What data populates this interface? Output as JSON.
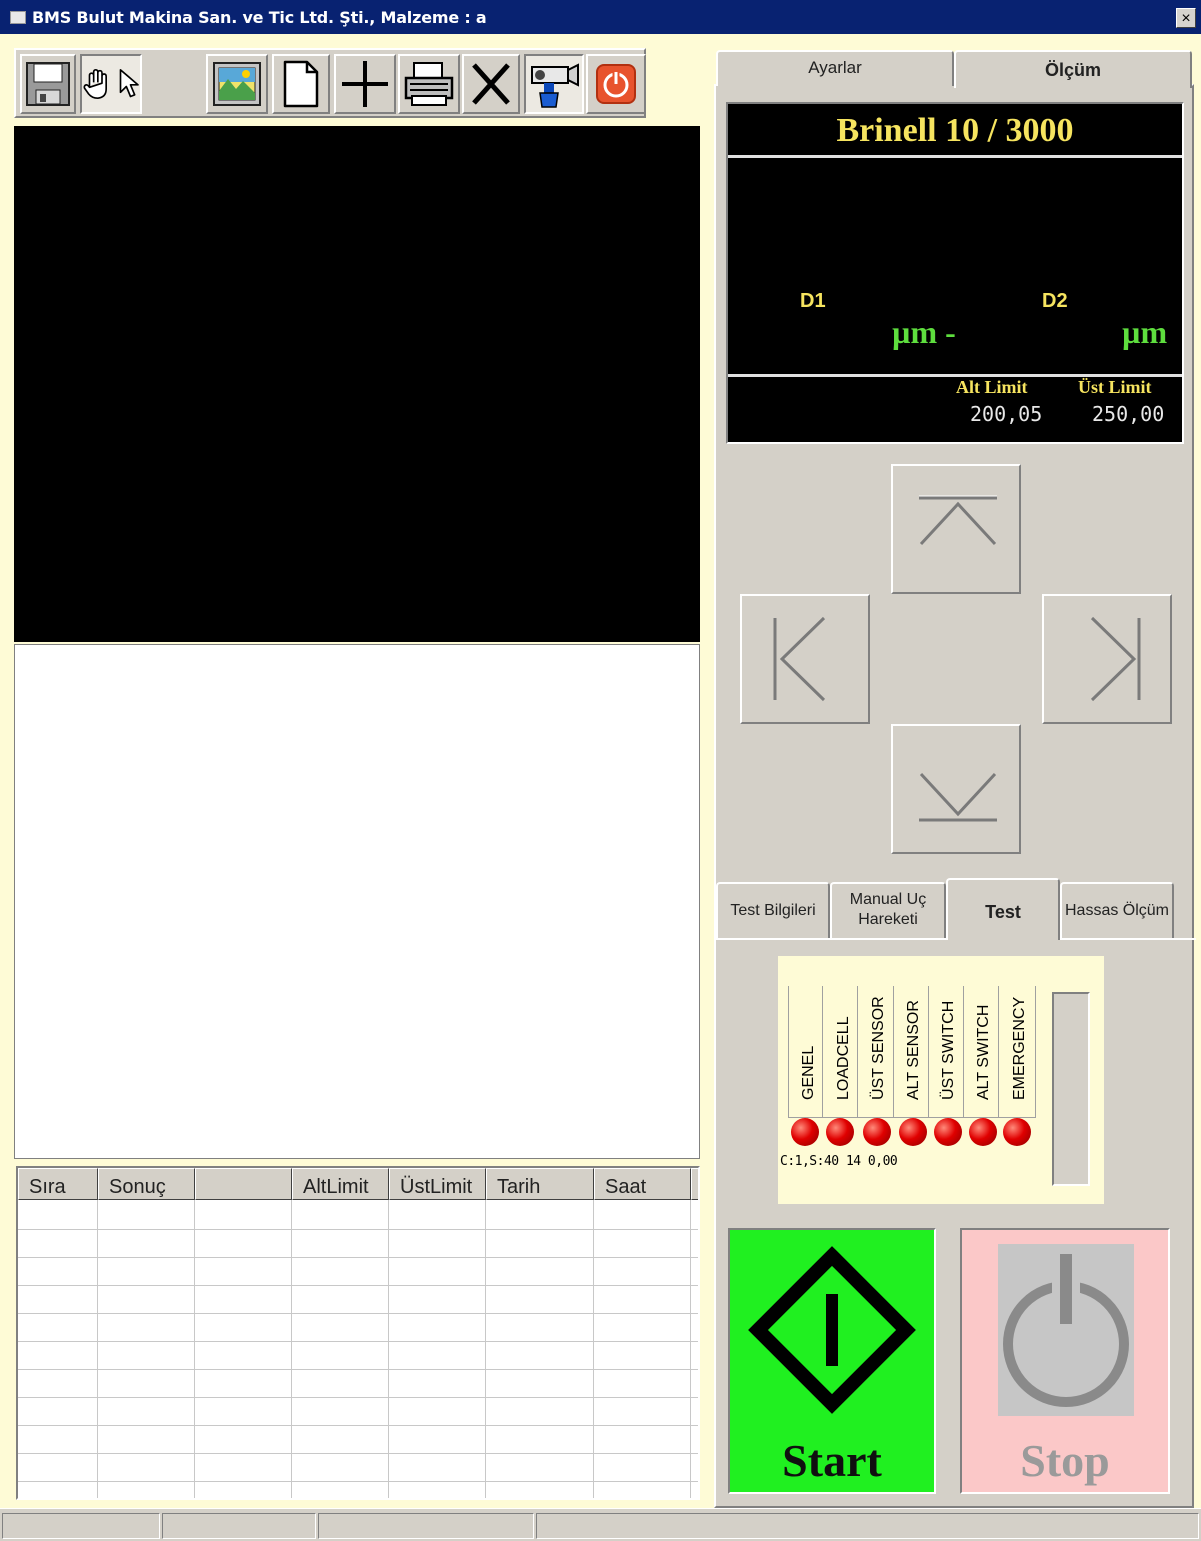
{
  "window": {
    "title": "BMS Bulut Makina San. ve Tic Ltd. Şti., Malzeme : a",
    "close": "×"
  },
  "toolbar": {
    "buttons": [
      {
        "name": "save-icon"
      },
      {
        "name": "hand-icon"
      },
      {
        "name": "pointer-icon"
      },
      {
        "name": "picture-icon"
      },
      {
        "name": "new-page-icon"
      },
      {
        "name": "crosshair-icon"
      },
      {
        "name": "print-icon"
      },
      {
        "name": "delete-icon"
      },
      {
        "name": "camera-icon"
      },
      {
        "name": "power-icon"
      }
    ]
  },
  "top_tabs": {
    "settings": "Ayarlar",
    "measurement": "Ölçüm",
    "active": "Ölçüm"
  },
  "measurement": {
    "title": "Brinell 10 / 3000",
    "d1_label": "D1",
    "d2_label": "D2",
    "d1_unit": "µm -",
    "d2_unit": "µm",
    "lower_limit_label": "Alt Limit",
    "upper_limit_label": "Üst Limit",
    "lower_limit_value": "200,05",
    "upper_limit_value": "250,00"
  },
  "bottom_tabs": {
    "test_info": "Test Bilgileri",
    "manual_move_line1": "Manual Uç",
    "manual_move_line2": "Hareketi",
    "test": "Test",
    "precise": "Hassas Ölçüm",
    "active": "Test"
  },
  "status_leds": [
    {
      "label": "GENEL",
      "state": "red"
    },
    {
      "label": "LOADCELL",
      "state": "red"
    },
    {
      "label": "ÜST SENSOR",
      "state": "red"
    },
    {
      "label": "ALT SENSOR",
      "state": "red"
    },
    {
      "label": "ÜST SWITCH",
      "state": "red"
    },
    {
      "label": "ALT SWITCH",
      "state": "red"
    },
    {
      "label": "EMERGENCY",
      "state": "red"
    }
  ],
  "status_text": "C:1,S:40 14 0,00",
  "start_label": "Start",
  "stop_label": "Stop",
  "grid": {
    "columns": [
      "Sıra",
      "Sonuç",
      "",
      "AltLimit",
      "ÜstLimit",
      "Tarih",
      "Saat"
    ],
    "rows": []
  },
  "colors": {
    "titlebar": "#082271",
    "background": "#fefbd6",
    "start": "#20f020",
    "stop": "#fbc8c8",
    "led": "#e00000",
    "display_yellow": "#f6e45f",
    "display_green": "#5ede3e"
  }
}
